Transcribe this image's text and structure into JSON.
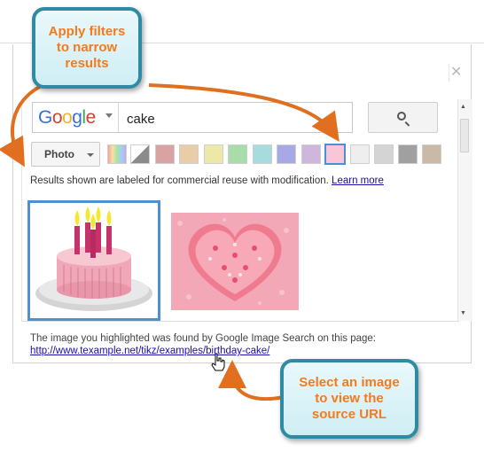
{
  "search": {
    "logo": "Google",
    "query": "cake",
    "button_icon": "search-icon"
  },
  "filters": {
    "type_label": "Photo",
    "colors": [
      "#rainbow",
      "#gray-mixed",
      "#d9a3a3",
      "#e9cda8",
      "#ece9a8",
      "#a8dca8",
      "#a8dcdc",
      "#a8a8e6",
      "#cfb6dc",
      "#f9c6d9",
      "#eeeeee",
      "#d4d4d4",
      "#a0a0a0",
      "#c9b9a6"
    ],
    "selected_color": "#f9c6d9"
  },
  "notice": {
    "text": "Results shown are labeled for commercial reuse with modification.",
    "link": "Learn more"
  },
  "results": {
    "items": [
      "birthday-cake-thumbnail",
      "heart-cake-thumbnail"
    ]
  },
  "source": {
    "text": "The image you highlighted was found by Google Image Search on this page:",
    "url": "http://www.texample.net/tikz/examples/birthday-cake/"
  },
  "callouts": {
    "top_lines": [
      "Apply filters",
      "to narrow",
      "results"
    ],
    "bottom_lines": [
      "Select an image",
      "to view the",
      "source URL"
    ]
  },
  "close_icon": "close-icon"
}
